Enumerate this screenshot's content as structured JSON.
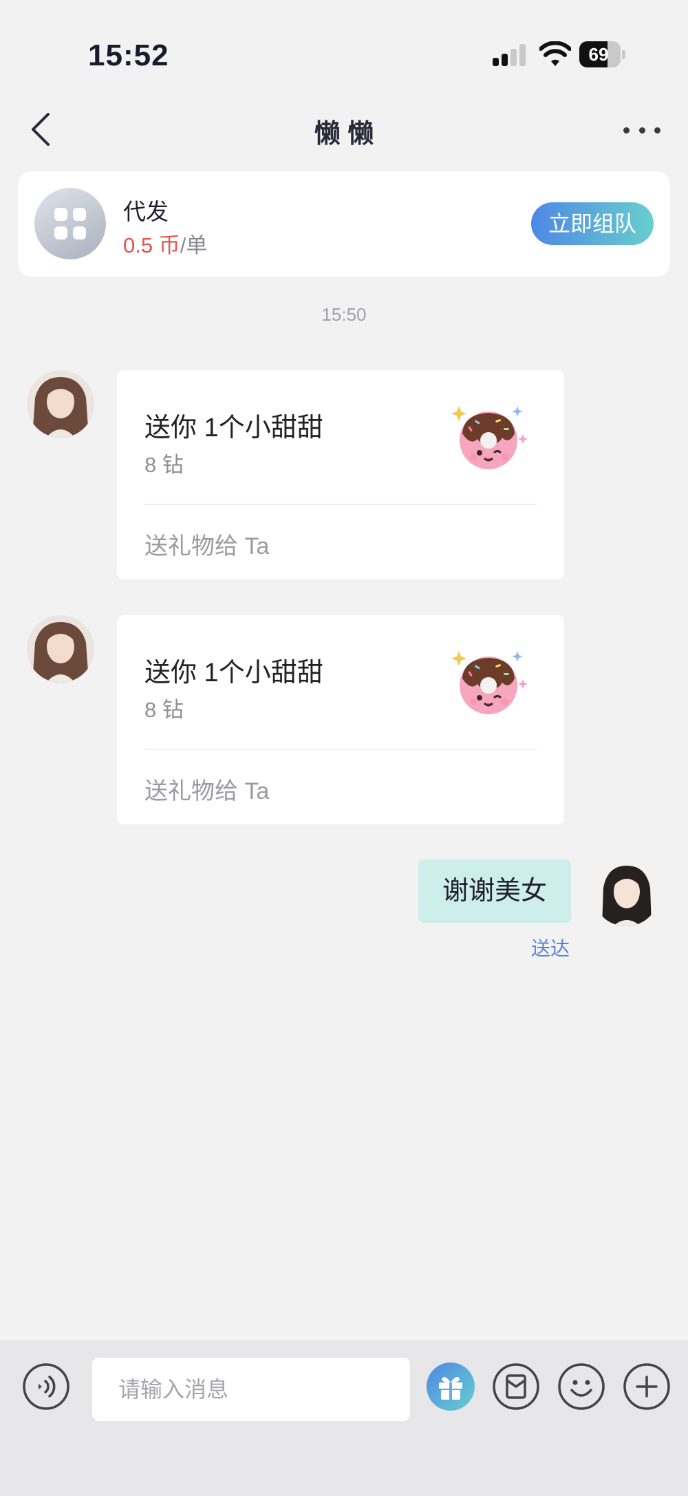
{
  "status_bar": {
    "time": "15:52",
    "battery": "69",
    "battery_level": 0.69
  },
  "nav": {
    "title": "懒 懒"
  },
  "service_card": {
    "name": "代发",
    "price_value": "0.5 币",
    "price_unit": "/单",
    "button_label": "立即组队"
  },
  "chat": {
    "timestamp": "15:50",
    "gift_messages": [
      {
        "title": "送你 1个小甜甜",
        "price": "8 钻",
        "action": "送礼物给 Ta"
      },
      {
        "title": "送你 1个小甜甜",
        "price": "8 钻",
        "action": "送礼物给 Ta"
      }
    ],
    "outgoing": {
      "text": "谢谢美女",
      "status": "送达"
    }
  },
  "composer": {
    "placeholder": "请输入消息"
  },
  "colors": {
    "accent_blue": "#4e87e6",
    "accent_teal": "#68cfcc",
    "price_red": "#e0544f",
    "bubble": "#cdeeea",
    "delivered": "#5a84d6"
  }
}
